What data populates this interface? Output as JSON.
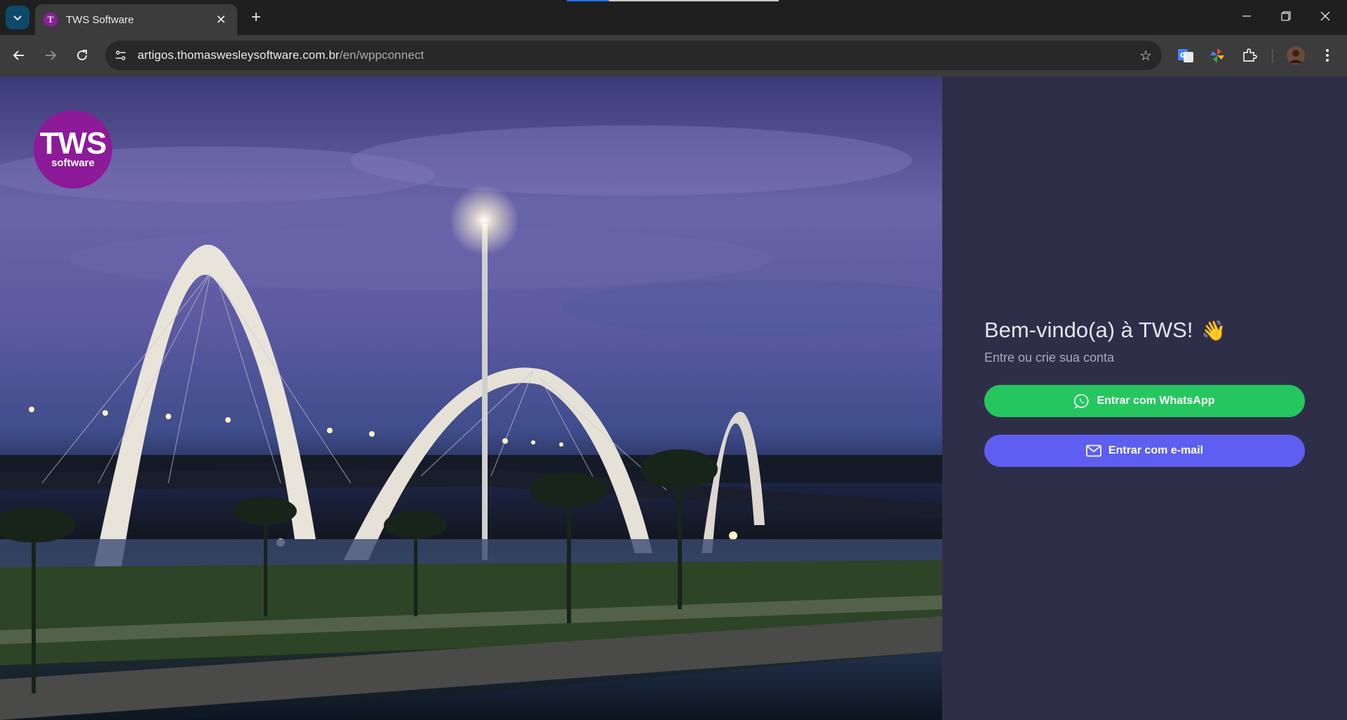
{
  "browser": {
    "tab_title": "TWS Software",
    "tab_favicon_letter": "T",
    "url_host": "artigos.thomaswesleysoftware.com.br",
    "url_path": "/en/wppconnect",
    "accent": "#8e1e9e"
  },
  "page": {
    "logo_text": "TWS",
    "logo_subtext": "software",
    "logo_color": "#8c1a99",
    "welcome_title": "Bem-vindo(a) à TWS!",
    "welcome_emoji": "👋",
    "subtitle": "Entre ou crie sua conta",
    "whatsapp_button": "Entrar com WhatsApp",
    "email_button": "Entrar com e-mail",
    "whatsapp_color": "#25c65f",
    "email_color": "#5e5ef0",
    "panel_color": "#2f2e48"
  }
}
